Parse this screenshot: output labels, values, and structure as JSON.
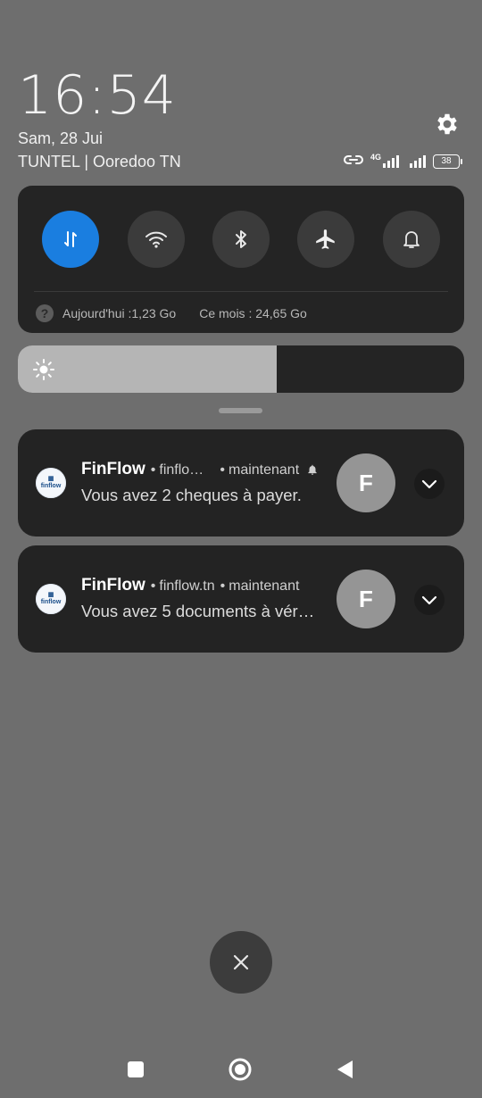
{
  "status": {
    "time": "16:54",
    "date": "Sam, 28 Jui",
    "carrier": "TUNTEL | Ooredoo TN",
    "network_label": "4G",
    "battery_level": "38",
    "icons": [
      "link-icon",
      "signal-4g-icon",
      "signal-icon",
      "battery-icon",
      "gear-icon"
    ]
  },
  "quick_settings": {
    "toggles": [
      {
        "name": "mobile-data",
        "icon": "data-transfer-icon",
        "active": true
      },
      {
        "name": "wifi",
        "icon": "wifi-icon",
        "active": false
      },
      {
        "name": "bluetooth",
        "icon": "bluetooth-icon",
        "active": false
      },
      {
        "name": "airplane-mode",
        "icon": "airplane-icon",
        "active": false
      },
      {
        "name": "sound",
        "icon": "bell-icon",
        "active": false
      }
    ],
    "usage_today": "Aujourd'hui :1,23 Go",
    "usage_month": "Ce mois : 24,65 Go",
    "accent": "#1a7ee0"
  },
  "brightness": {
    "level": 0.58
  },
  "notifications": [
    {
      "app": "FinFlow",
      "source": "finflo…",
      "time": "maintenant",
      "body": "Vous avez 2 cheques à payer.",
      "avatar": "F",
      "bell": true
    },
    {
      "app": "FinFlow",
      "source": "finflow.tn",
      "time": "maintenant",
      "body": "Vous avez 5 documents à vér…",
      "avatar": "F",
      "bell": false
    }
  ],
  "logo_text": "finflow"
}
